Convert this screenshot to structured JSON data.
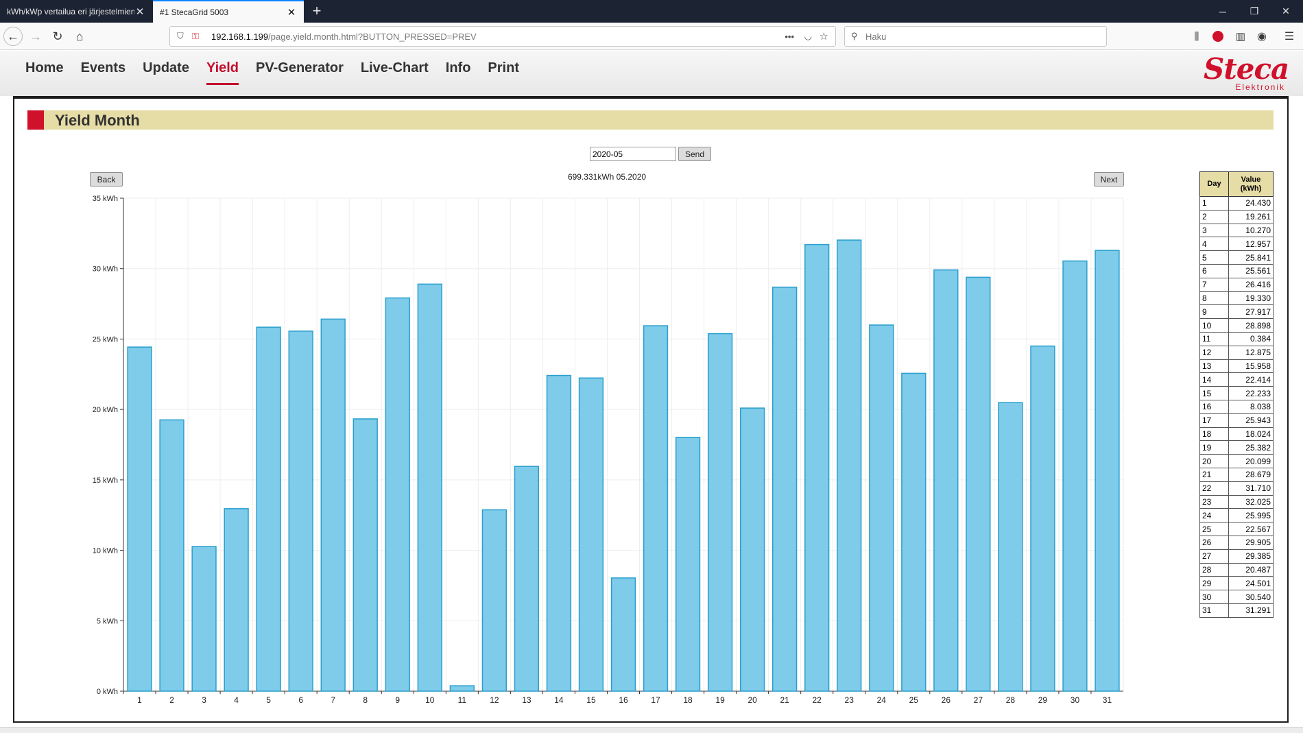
{
  "browser": {
    "tabs": [
      {
        "title": "kWh/kWp vertailua eri järjestelmien",
        "active": false
      },
      {
        "title": "#1 StecaGrid 5003",
        "active": true
      }
    ],
    "url_host": "192.168.1.199",
    "url_path": "/page.yield.month.html?BUTTON_PRESSED=PREV",
    "search_placeholder": "Haku"
  },
  "nav": {
    "items": [
      "Home",
      "Events",
      "Update",
      "Yield",
      "PV-Generator",
      "Live-Chart",
      "Info",
      "Print"
    ],
    "active": "Yield"
  },
  "logo": {
    "main": "Steca",
    "sub": "Elektronik"
  },
  "page": {
    "title": "Yield Month",
    "month_value": "2020-05",
    "send_label": "Send",
    "back_label": "Back",
    "next_label": "Next",
    "total_label": "699.331kWh 05.2020"
  },
  "colors": {
    "accent": "#d0112b",
    "title_bar": "#e6dca5",
    "bar_fill": "#7ecbea",
    "bar_stroke": "#2a9fcd"
  },
  "table": {
    "headers": {
      "day": "Day",
      "value_line1": "Value",
      "value_line2": "(kWh)"
    },
    "rows": [
      [
        "1",
        "24.430"
      ],
      [
        "2",
        "19.261"
      ],
      [
        "3",
        "10.270"
      ],
      [
        "4",
        "12.957"
      ],
      [
        "5",
        "25.841"
      ],
      [
        "6",
        "25.561"
      ],
      [
        "7",
        "26.416"
      ],
      [
        "8",
        "19.330"
      ],
      [
        "9",
        "27.917"
      ],
      [
        "10",
        "28.898"
      ],
      [
        "11",
        "0.384"
      ],
      [
        "12",
        "12.875"
      ],
      [
        "13",
        "15.958"
      ],
      [
        "14",
        "22.414"
      ],
      [
        "15",
        "22.233"
      ],
      [
        "16",
        "8.038"
      ],
      [
        "17",
        "25.943"
      ],
      [
        "18",
        "18.024"
      ],
      [
        "19",
        "25.382"
      ],
      [
        "20",
        "20.099"
      ],
      [
        "21",
        "28.679"
      ],
      [
        "22",
        "31.710"
      ],
      [
        "23",
        "32.025"
      ],
      [
        "24",
        "25.995"
      ],
      [
        "25",
        "22.567"
      ],
      [
        "26",
        "29.905"
      ],
      [
        "27",
        "29.385"
      ],
      [
        "28",
        "20.487"
      ],
      [
        "29",
        "24.501"
      ],
      [
        "30",
        "30.540"
      ],
      [
        "31",
        "31.291"
      ]
    ]
  },
  "chart_data": {
    "type": "bar",
    "title": "699.331kWh 05.2020",
    "xlabel": "",
    "ylabel": "",
    "ylim": [
      0,
      35
    ],
    "yticks": [
      "0 kWh",
      "5 kWh",
      "10 kWh",
      "15 kWh",
      "20 kWh",
      "25 kWh",
      "30 kWh",
      "35 kWh"
    ],
    "ytick_values": [
      0,
      5,
      10,
      15,
      20,
      25,
      30,
      35
    ],
    "categories": [
      "1",
      "2",
      "3",
      "4",
      "5",
      "6",
      "7",
      "8",
      "9",
      "10",
      "11",
      "12",
      "13",
      "14",
      "15",
      "16",
      "17",
      "18",
      "19",
      "20",
      "21",
      "22",
      "23",
      "24",
      "25",
      "26",
      "27",
      "28",
      "29",
      "30",
      "31"
    ],
    "values": [
      24.43,
      19.261,
      10.27,
      12.957,
      25.841,
      25.561,
      26.416,
      19.33,
      27.917,
      28.898,
      0.384,
      12.875,
      15.958,
      22.414,
      22.233,
      8.038,
      25.943,
      18.024,
      25.382,
      20.099,
      28.679,
      31.71,
      32.025,
      25.995,
      22.567,
      29.905,
      29.385,
      20.487,
      24.501,
      30.54,
      31.291
    ],
    "grid": true,
    "legend": "none"
  }
}
